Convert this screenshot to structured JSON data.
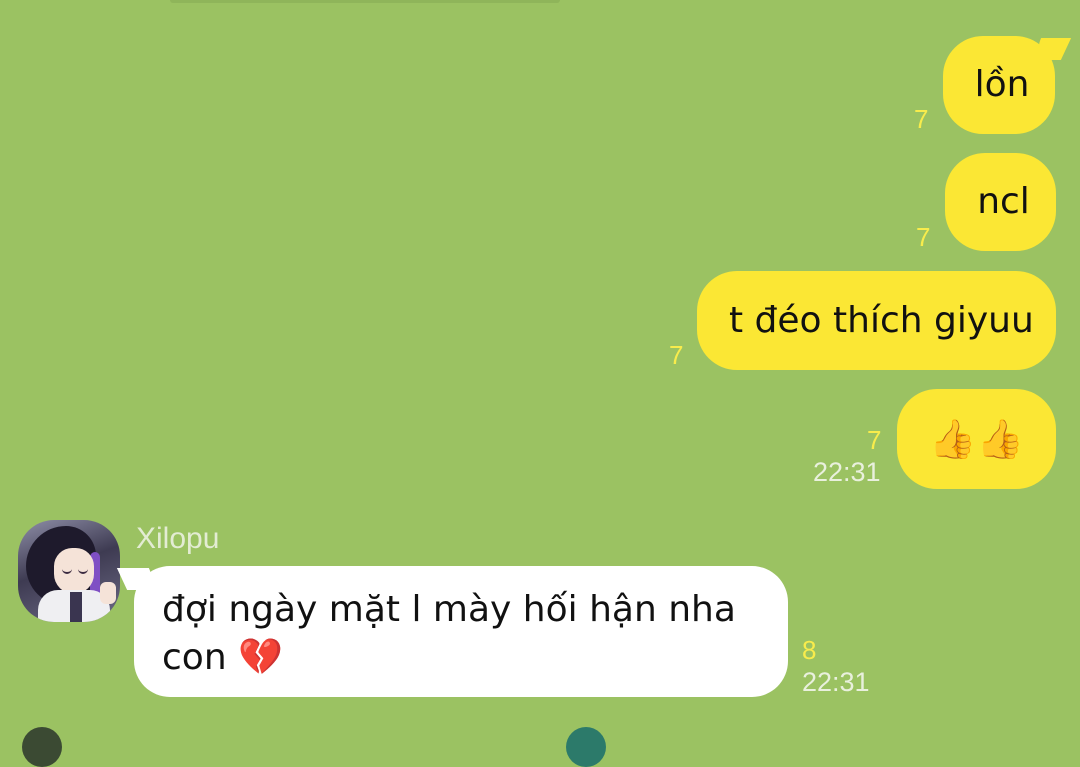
{
  "messages": [
    {
      "text": "lồn",
      "read": "7"
    },
    {
      "text": "ncl",
      "read": "7"
    },
    {
      "text": "t đéo thích giyuu",
      "read": "7"
    },
    {
      "text": "👍👍",
      "read": "7",
      "time": "22:31"
    }
  ],
  "incoming": {
    "sender": "Xilopu",
    "text": "đợi ngày mặt l mày hối hận nha con 💔",
    "read": "8",
    "time": "22:31"
  }
}
